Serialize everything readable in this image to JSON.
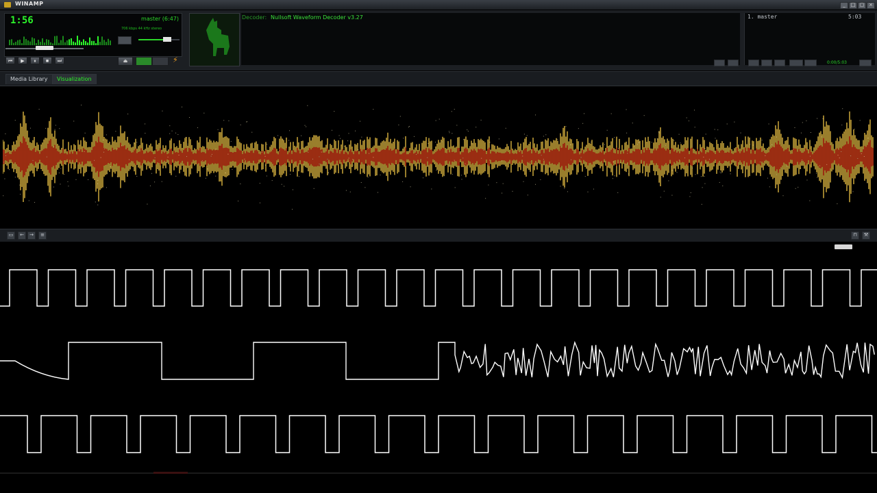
{
  "app": {
    "title": "WINAMP"
  },
  "titlebar_buttons": [
    "_",
    "□",
    "▢",
    "×"
  ],
  "player": {
    "time": "1:56",
    "track_title": "master (6:47)",
    "kbps_text": "706 kbps   44 kHz   stereo",
    "progress": 0.42,
    "volume": 0.8,
    "controls": {
      "prev": "⏮",
      "play": "▶",
      "pause": "⏸",
      "stop": "■",
      "next": "⏭",
      "eject": "⏏"
    }
  },
  "decoder": {
    "label": "Decoder:",
    "value": "Nullsoft Waveform Decoder v3.27"
  },
  "playlist": {
    "items": [
      {
        "label": "1. master",
        "time": "5:03"
      }
    ],
    "total": "0:00/5:03"
  },
  "tabs": [
    {
      "label": "Media Library",
      "active": false
    },
    {
      "label": "Visualization",
      "active": true
    }
  ],
  "viz_toolbar_icons": [
    "window-icon",
    "back-icon",
    "forward-icon",
    "menu-icon"
  ],
  "colors": {
    "accent": "#2cf52a",
    "viz_hot": "#ffd24a",
    "viz_core": "#e02010",
    "scope_line": "#ffffff"
  }
}
